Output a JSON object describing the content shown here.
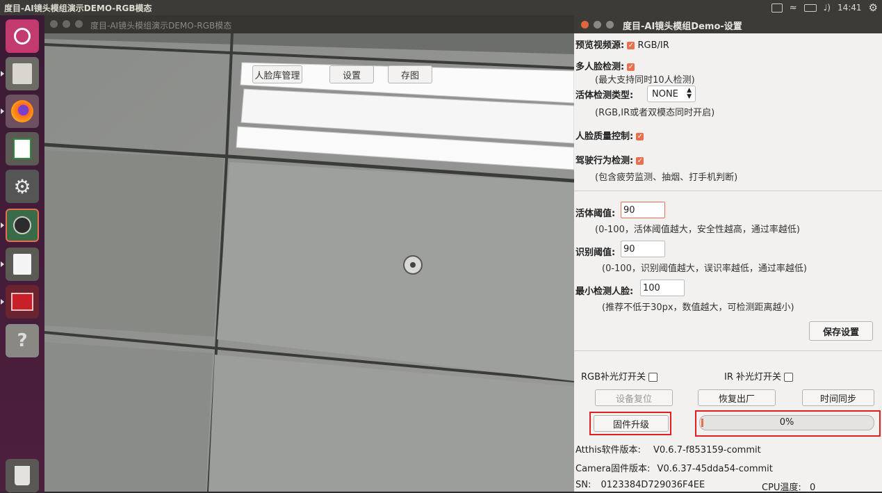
{
  "topbar": {
    "app_title": "度目-AI镜头模组演示DEMO-RGB模态",
    "clock": "14:41"
  },
  "camera_window": {
    "title": "度目-AI镜头模组演示DEMO-RGB模态",
    "buttons": {
      "face_db": "人脸库管理",
      "settings": "设置",
      "save_image": "存图"
    }
  },
  "settings_window": {
    "title": "度目-AI镜头模组Demo-设置",
    "preview_source": {
      "label": "预览视频源:",
      "option": "RGB/IR"
    },
    "multi_face": {
      "label": "多人脸检测:",
      "note": "(最大支持同时10人检测)"
    },
    "liveness_type": {
      "label": "活体检测类型:",
      "value": "NONE",
      "note": "(RGB,IR或者双模态同时开启)"
    },
    "face_quality": {
      "label": "人脸质量控制:"
    },
    "driving_behavior": {
      "label": "驾驶行为检测:",
      "note": "(包含疲劳监测、抽烟、打手机判断)"
    },
    "liveness_threshold": {
      "label": "活体阈值:",
      "value": "90",
      "note": "(0-100，活体阈值越大，安全性越高，通过率越低)"
    },
    "recognition_threshold": {
      "label": "识别阈值:",
      "value": "90",
      "note": "(0-100，识别阈值越大，误识率越低，通过率越低)"
    },
    "min_face": {
      "label": "最小检测人脸:",
      "value": "100",
      "note": "(推荐不低于30px，数值越大，可检测距离越小)"
    },
    "save_button": "保存设置",
    "rgb_light": "RGB补光灯开关",
    "ir_light": "IR 补光灯开关",
    "device_reset": "设备复位",
    "factory_reset": "恢复出厂",
    "time_sync": "时间同步",
    "firmware_upgrade": "固件升级",
    "progress": {
      "text": "0%",
      "value": 0
    },
    "atthis_version": {
      "label": "Atthis软件版本:",
      "value": "V0.6.7-f853159-commit"
    },
    "camera_version": {
      "label": "Camera固件版本:",
      "value": "V0.6.37-45dda54-commit"
    },
    "sn": {
      "label": "SN:",
      "value": "0123384D729036F4EE"
    },
    "cpu_temp": {
      "label": "CPU温度:",
      "value": "0"
    }
  },
  "colors": {
    "accent": "#e8704f",
    "highlight": "#e02020",
    "launcher": "#4a1d3c"
  }
}
